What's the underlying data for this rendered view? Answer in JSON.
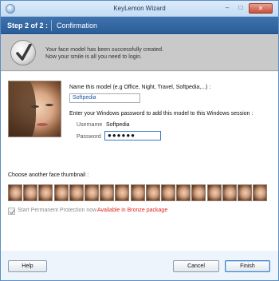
{
  "window": {
    "title": "KeyLemon Wizard",
    "min_glyph": "–",
    "max_glyph": "□",
    "close_glyph": "✕"
  },
  "step": {
    "number": "Step 2 of 2 :",
    "title": "Confirmation"
  },
  "banner": {
    "line1": "Your face model has been successfully created.",
    "line2": "Now your smile is all you need to login.",
    "icon": "checkmark-icon"
  },
  "model": {
    "name_label": "Name this model (e.g Office, Night, Travel, Softpedia,...) :",
    "name_value": "Softpedia",
    "password_prompt": "Enter your Windows password to add this model to this Windows session :",
    "username_label": "Username",
    "username_value": "Softpedia",
    "password_label": "Password",
    "password_value": "●●●●●●"
  },
  "thumbnails": {
    "label": "Choose another face thumbnail :",
    "count": 17
  },
  "protection": {
    "label": "Start Permanent Protection now",
    "checked": true,
    "note": "Available in Bronze package",
    "note_color": "#e0241c"
  },
  "buttons": {
    "help": "Help",
    "cancel": "Cancel",
    "finish": "Finish"
  },
  "colors": {
    "step_bar": "#2f639e",
    "banner": "#c9c9c9",
    "accent": "#3c7fc5"
  }
}
